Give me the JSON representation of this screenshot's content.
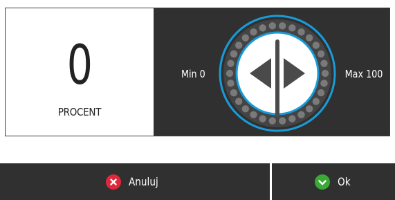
{
  "display": {
    "value": "0",
    "unit": "PROCENT"
  },
  "range": {
    "min_label": "Min 0",
    "max_label": "Max 100",
    "current_percent": 0
  },
  "buttons": {
    "cancel_label": "Anuluj",
    "ok_label": "Ok"
  },
  "icons": {
    "cancel": "close-circle-icon",
    "ok": "check-circle-icon",
    "left": "triangle-left-icon",
    "right": "triangle-right-icon"
  },
  "colors": {
    "background_dark": "#303030",
    "ring_blue": "#1a9bd7",
    "dot_gray": "#7a7a7a",
    "cancel_red": "#e0283c",
    "ok_green": "#3aa935"
  }
}
